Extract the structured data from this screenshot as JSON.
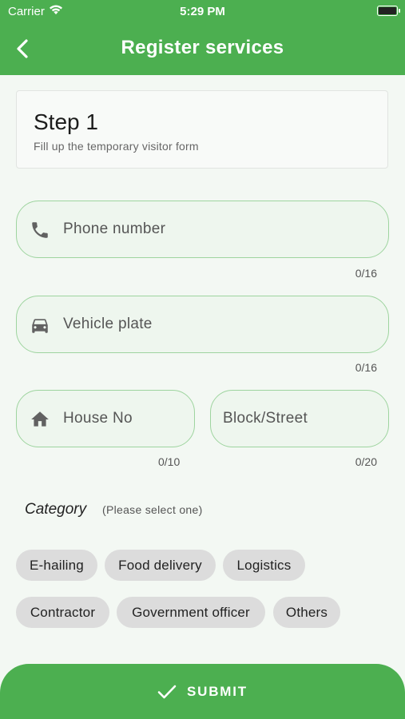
{
  "status_bar": {
    "carrier": "Carrier",
    "time": "5:29 PM"
  },
  "app_bar": {
    "title": "Register services",
    "back_icon": "chevron-left-icon"
  },
  "step": {
    "title": "Step 1",
    "subtitle": "Fill up the temporary visitor form"
  },
  "fields": {
    "phone": {
      "placeholder": "Phone number",
      "counter": "0/16",
      "icon": "phone-icon"
    },
    "vehicle": {
      "placeholder": "Vehicle plate",
      "counter": "0/16",
      "icon": "car-icon"
    },
    "house": {
      "placeholder": "House No",
      "counter": "0/10",
      "icon": "home-icon"
    },
    "block": {
      "placeholder": "Block/Street",
      "counter": "0/20"
    }
  },
  "category": {
    "label": "Category",
    "hint": "(Please select one)",
    "options": [
      "E-hailing",
      "Food delivery",
      "Logistics",
      "Contractor",
      "Government officer",
      "Others"
    ]
  },
  "submit": {
    "label": "SUBMIT",
    "icon": "check-icon"
  },
  "colors": {
    "primary": "#4caf50",
    "field_border": "#9ed49f",
    "chip_bg": "#dcdcdc",
    "background": "#f3f8f3"
  }
}
